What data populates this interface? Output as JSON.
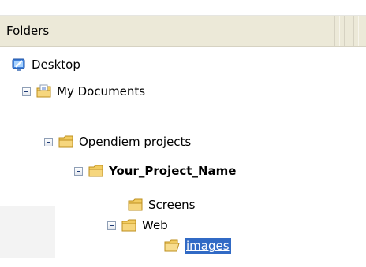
{
  "header": {
    "title": "Folders"
  },
  "tree": {
    "items": [
      {
        "label": "Desktop",
        "icon": "desktop-icon",
        "expanded": null
      },
      {
        "label": "My Documents",
        "icon": "documents-folder-icon",
        "expanded": true
      },
      {
        "label": "Opendiem projects",
        "icon": "folder-icon",
        "expanded": true
      },
      {
        "label": "Your_Project_Name",
        "icon": "folder-icon",
        "expanded": true
      },
      {
        "label": "Screens",
        "icon": "folder-icon",
        "expanded": null
      },
      {
        "label": "Web",
        "icon": "folder-icon",
        "expanded": true
      },
      {
        "label": "images",
        "icon": "open-folder-icon",
        "expanded": null,
        "selected": true
      }
    ]
  },
  "colors": {
    "selection": "#316ac5",
    "header_bg": "#ece9d8",
    "folder_yellow": "#f2cc61"
  }
}
